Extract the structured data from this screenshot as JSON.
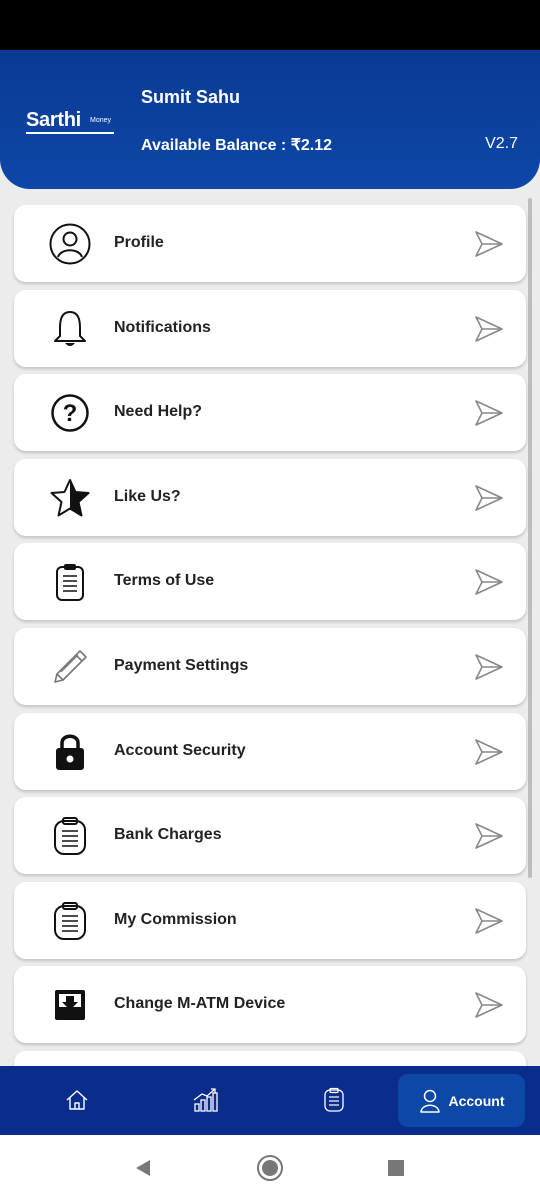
{
  "app": {
    "logo_text": "Sarthi",
    "logo_sub": "Money",
    "user_name": "Sumit Sahu",
    "balance_text": "Available Balance : ₹2.12",
    "version": "V2.7"
  },
  "menu": {
    "items": [
      {
        "label": "Profile",
        "icon": "user-circle-icon"
      },
      {
        "label": "Notifications",
        "icon": "bell-icon"
      },
      {
        "label": "Need Help?",
        "icon": "question-circle-icon"
      },
      {
        "label": "Like Us?",
        "icon": "star-icon"
      },
      {
        "label": "Terms of Use",
        "icon": "clipboard-icon"
      },
      {
        "label": "Payment Settings",
        "icon": "pencil-icon"
      },
      {
        "label": "Account Security",
        "icon": "lock-icon"
      },
      {
        "label": "Bank Charges",
        "icon": "clipboard-icon"
      },
      {
        "label": "My Commission",
        "icon": "clipboard-icon"
      },
      {
        "label": "Change M-ATM Device",
        "icon": "download-box-icon"
      }
    ]
  },
  "bottom_nav": {
    "items": [
      {
        "icon": "home-icon"
      },
      {
        "icon": "chart-icon"
      },
      {
        "icon": "clipboard-icon"
      }
    ],
    "active_label": "Account",
    "active_icon": "user-icon"
  },
  "colors": {
    "header": "#0d47a8",
    "bottom_nav": "#0a2c8a",
    "active_tab": "#0d47a8"
  }
}
